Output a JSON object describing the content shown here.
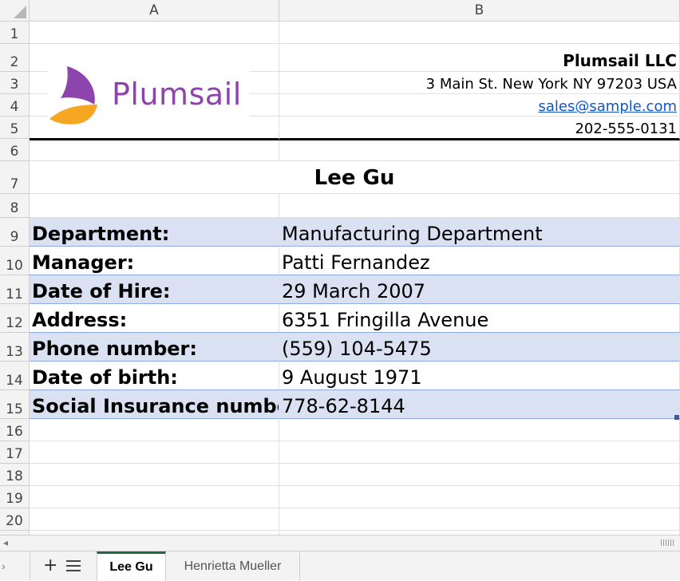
{
  "columns": [
    "A",
    "B"
  ],
  "rows": [
    "1",
    "2",
    "3",
    "4",
    "5",
    "6",
    "7",
    "8",
    "9",
    "10",
    "11",
    "12",
    "13",
    "14",
    "15",
    "16",
    "17",
    "18",
    "19",
    "20"
  ],
  "logo": {
    "text": "Plumsail"
  },
  "company": {
    "name": "Plumsail LLC",
    "address": "3 Main St. New York NY 97203 USA",
    "email": "sales@sample.com",
    "phone": "202-555-0131"
  },
  "employee_name": "Lee Gu",
  "fields": [
    {
      "label": "Department:",
      "value": "Manufacturing Department"
    },
    {
      "label": "Manager:",
      "value": "Patti Fernandez"
    },
    {
      "label": "Date of Hire:",
      "value": "29 March 2007"
    },
    {
      "label": "Address:",
      "value": "6351 Fringilla Avenue"
    },
    {
      "label": "Phone number:",
      "value": "(559) 104-5475"
    },
    {
      "label": "Date of birth:",
      "value": "9 August 1971"
    },
    {
      "label": "Social Insurance number:",
      "value": "778-62-8144"
    }
  ],
  "sheets": [
    {
      "label": "Lee Gu",
      "active": true
    },
    {
      "label": "Henrietta Mueller",
      "active": false
    }
  ],
  "colors": {
    "accent_tab": "#1e6b41",
    "row_band": "#d9e1f2",
    "logo_purple": "#8e44ad",
    "logo_orange": "#f5a623",
    "link": "#1155cc"
  }
}
